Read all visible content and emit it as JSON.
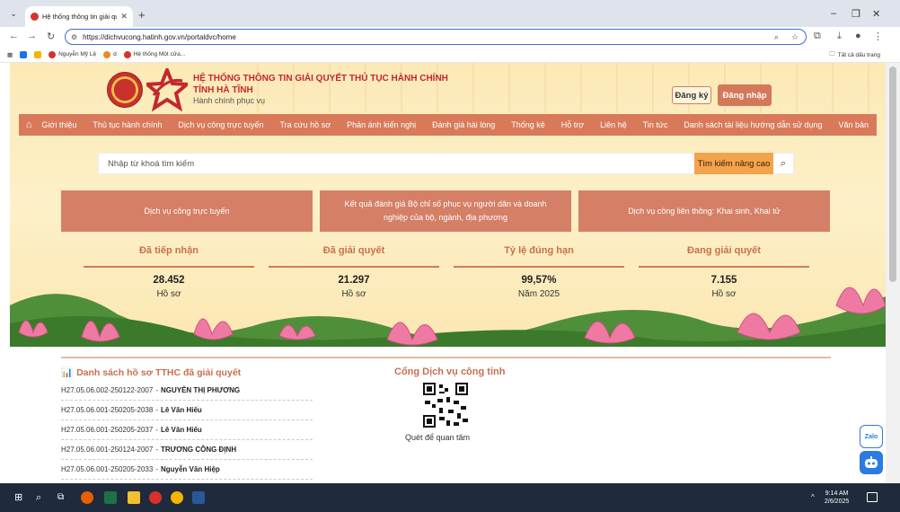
{
  "browser": {
    "tab_title": "Hệ thống thông tin giải quyết t",
    "url": "https://dichvucong.hatinh.gov.vn/portaldvc/home",
    "bookmarks": [
      "Nguyễn Mỹ Lệ",
      "d",
      "Hệ thống Một cửa..."
    ],
    "all_bookmarks": "Tất cả dấu trang"
  },
  "header": {
    "title_line1": "HỆ THỐNG THÔNG TIN GIẢI QUYẾT THỦ TỤC HÀNH CHÍNH",
    "title_line2": "TỈNH HÀ TĨNH",
    "subtitle": "Hành chính phục vụ",
    "register_label": "Đăng ký",
    "login_label": "Đăng nhập"
  },
  "menu": {
    "items": [
      "Giới thiệu",
      "Thủ tục hành chính",
      "Dịch vụ công trực tuyến",
      "Tra cứu hồ sơ",
      "Phản ánh kiến nghị",
      "Đánh giá hài lòng",
      "Thống kê",
      "Hỗ trợ",
      "Liên hệ",
      "Tin tức",
      "Danh sách tài liệu hướng dẫn sử dụng",
      "Văn bản"
    ]
  },
  "search": {
    "placeholder": "Nhập từ khoá tìm kiếm",
    "advanced_label": "Tìm kiếm nâng cao"
  },
  "cards": [
    {
      "line1": "Dịch vụ công trực tuyến",
      "line2": ""
    },
    {
      "line1": "Kết quả đánh giá Bộ chỉ số phục vụ người dân và doanh",
      "line2": "nghiệp của bộ, ngành, địa phương"
    },
    {
      "line1": "Dịch vụ công liên thông: Khai sinh, Khai tử",
      "line2": ""
    }
  ],
  "stats": [
    {
      "label": "Đã tiếp nhận",
      "value": "28.452",
      "unit": "Hồ sơ"
    },
    {
      "label": "Đã giải quyết",
      "value": "21.297",
      "unit": "Hồ sơ"
    },
    {
      "label": "Tỷ lệ đúng hạn",
      "value": "99,57%",
      "unit": "Năm 2025"
    },
    {
      "label": "Đang giải quyết",
      "value": "7.155",
      "unit": "Hồ sơ"
    }
  ],
  "resolved_list": {
    "title": "Danh sách hồ sơ TTHC đã giải quyết",
    "items": [
      {
        "code": "H27.05.06.002-250122-2007",
        "name": "NGUYỄN THỊ PHƯƠNG"
      },
      {
        "code": "H27.05.06.001-250205-2038",
        "name": "Lê Văn Hiếu"
      },
      {
        "code": "H27.05.06.001-250205-2037",
        "name": "Lê Văn Hiếu"
      },
      {
        "code": "H27.05.06.001-250124-2007",
        "name": "TRƯƠNG CÔNG ĐỊNH"
      },
      {
        "code": "H27.05.06.001-250205-2033",
        "name": "Nguyễn Văn Hiệp"
      }
    ]
  },
  "portal": {
    "title": "Cổng Dịch vụ công tỉnh",
    "qr_caption": "Quét để quan tâm"
  },
  "floating": {
    "zalo_label": "Zalo"
  },
  "taskbar": {
    "time": "9:14 AM",
    "date": "2/6/2025"
  },
  "colors": {
    "accent": "#d87a5a",
    "title_red": "#c2282d",
    "search_adv": "#f3a34c"
  }
}
